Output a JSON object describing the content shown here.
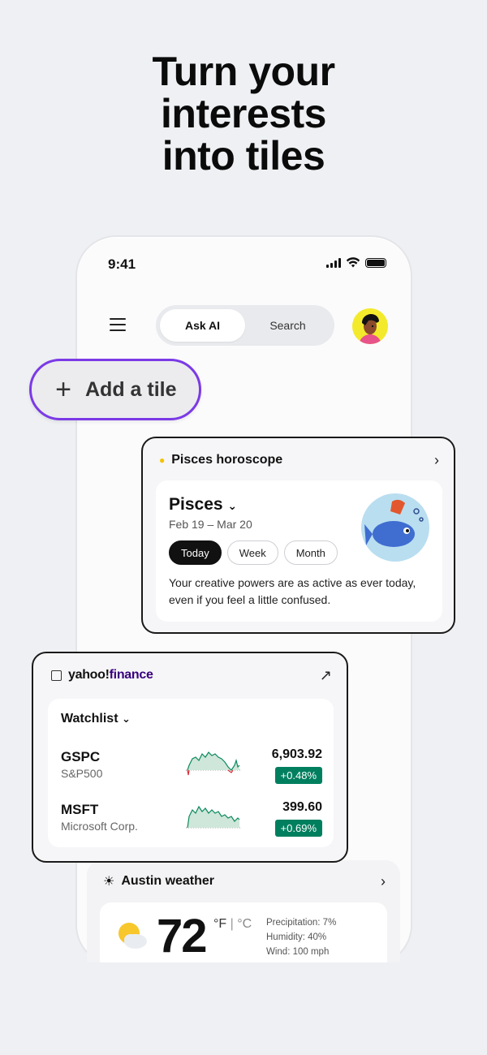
{
  "headline": [
    "Turn your",
    "interests",
    "into tiles"
  ],
  "status": {
    "time": "9:41"
  },
  "header": {
    "tabs": [
      {
        "label": "Ask AI",
        "active": true
      },
      {
        "label": "Search",
        "active": false
      }
    ]
  },
  "add_tile": {
    "icon": "plus-icon",
    "label": "Add a tile",
    "accent": "#7b3ae6"
  },
  "horoscope": {
    "title": "Pisces horoscope",
    "sign": "Pisces",
    "dates": "Feb 19 – Mar 20",
    "pills": [
      {
        "label": "Today",
        "active": true
      },
      {
        "label": "Week",
        "active": false
      },
      {
        "label": "Month",
        "active": false
      }
    ],
    "text": "Your creative powers are as active as ever today, even if you feel a little confused."
  },
  "finance": {
    "brand": "yahoo!finance",
    "watchlist_label": "Watchlist",
    "rows": [
      {
        "symbol": "GSPC",
        "name": "S&P500",
        "price": "6,903.92",
        "change": "+0.48%"
      },
      {
        "symbol": "MSFT",
        "name": "Microsoft Corp.",
        "price": "399.60",
        "change": "+0.69%"
      }
    ],
    "positive_color": "#007f5f"
  },
  "weather": {
    "title": "Austin weather",
    "temp": "72",
    "unit_f": "°F",
    "unit_c": "°C",
    "precip": "Precipitation: 7%",
    "humidity": "Humidity: 40%",
    "wind": "Wind: 100 mph"
  }
}
